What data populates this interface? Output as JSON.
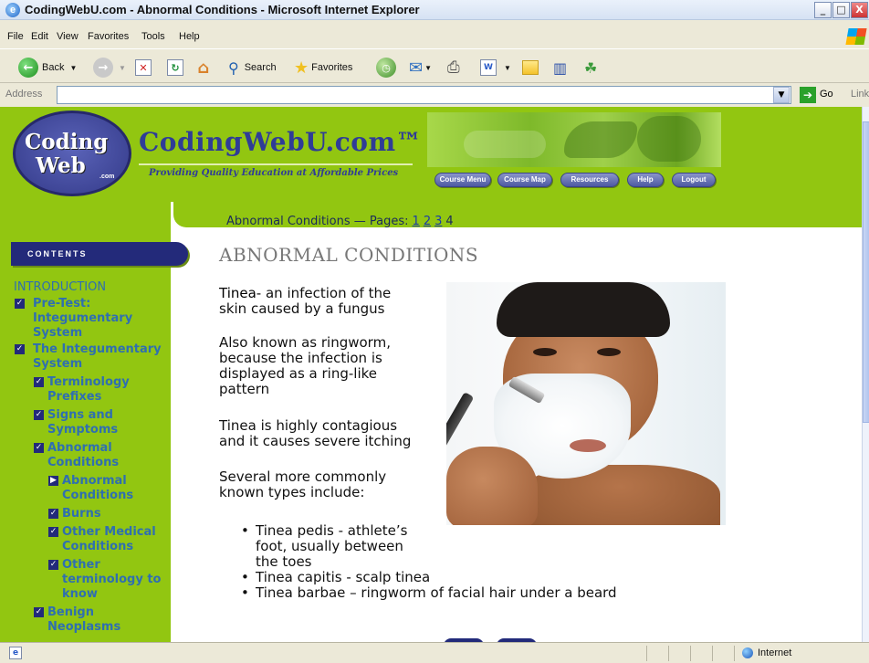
{
  "window": {
    "title": "CodingWebU.com - Abnormal Conditions - Microsoft Internet Explorer",
    "controls": {
      "minimize": "_",
      "maximize": "□",
      "close": "X"
    }
  },
  "menu": [
    "File",
    "Edit",
    "View",
    "Favorites",
    "Tools",
    "Help"
  ],
  "toolbar": {
    "back_label": "Back",
    "search_label": "Search",
    "favorites_label": "Favorites"
  },
  "address": {
    "label": "Address",
    "value": "",
    "go_label": "Go",
    "links_label": "Link"
  },
  "site": {
    "logo_line1": "Coding",
    "logo_line2": "Web",
    "logo_com": ".com",
    "name": "CodingWebU.com™",
    "tagline": "Providing Quality Education at Affordable Prices",
    "nav": [
      "Course Menu",
      "Course Map",
      "Resources",
      "Help",
      "Logout"
    ]
  },
  "sidebar": {
    "contents_label": "CONTENTS",
    "intro": "INTRODUCTION",
    "items": [
      {
        "label_lines": [
          "Pre-Test:",
          "Integumentary",
          "System"
        ],
        "marker": "☑"
      },
      {
        "label_lines": [
          "The Integumentary",
          "System"
        ],
        "marker": "☑"
      },
      {
        "label_lines": [
          "Terminology",
          "Prefixes"
        ],
        "marker": "☑"
      },
      {
        "label_lines": [
          "Signs and",
          "Symptoms"
        ],
        "marker": "☑"
      },
      {
        "label_lines": [
          "Abnormal",
          "Conditions"
        ],
        "marker": "☑"
      },
      {
        "label_lines": [
          "Abnormal",
          "Conditions"
        ],
        "marker": "▶"
      },
      {
        "label_lines": [
          "Burns"
        ],
        "marker": "☑"
      },
      {
        "label_lines": [
          "Other Medical",
          "Conditions"
        ],
        "marker": "☑"
      },
      {
        "label_lines": [
          "Other",
          "terminology to",
          "know"
        ],
        "marker": "☑"
      },
      {
        "label_lines": [
          "Benign",
          "Neoplasms"
        ],
        "marker": "☑"
      }
    ]
  },
  "page": {
    "breadcrumb_prefix": "Abnormal Conditions — Pages:",
    "pages": [
      "1",
      "2",
      "3"
    ],
    "current_page": "4",
    "heading": "ABNORMAL CONDITIONS",
    "term": "Tinea",
    "definition_lines": [
      "- an infection of the",
      "skin caused by a fungus"
    ],
    "para2_lines": [
      "Also known as ringworm,",
      "because the infection is",
      "displayed as a ring-like",
      "pattern"
    ],
    "para3_lines": [
      "Tinea is highly contagious",
      "and it causes severe itching"
    ],
    "para4_lines": [
      "Several more commonly",
      "known types include:"
    ],
    "types": [
      [
        "Tinea pedis - athlete’s",
        "foot, usually between",
        "the toes"
      ],
      [
        "Tinea capitis - scalp tinea"
      ],
      [
        "Tinea barbae – ringworm of facial hair under a beard"
      ]
    ]
  },
  "status": {
    "zone": "Internet"
  }
}
